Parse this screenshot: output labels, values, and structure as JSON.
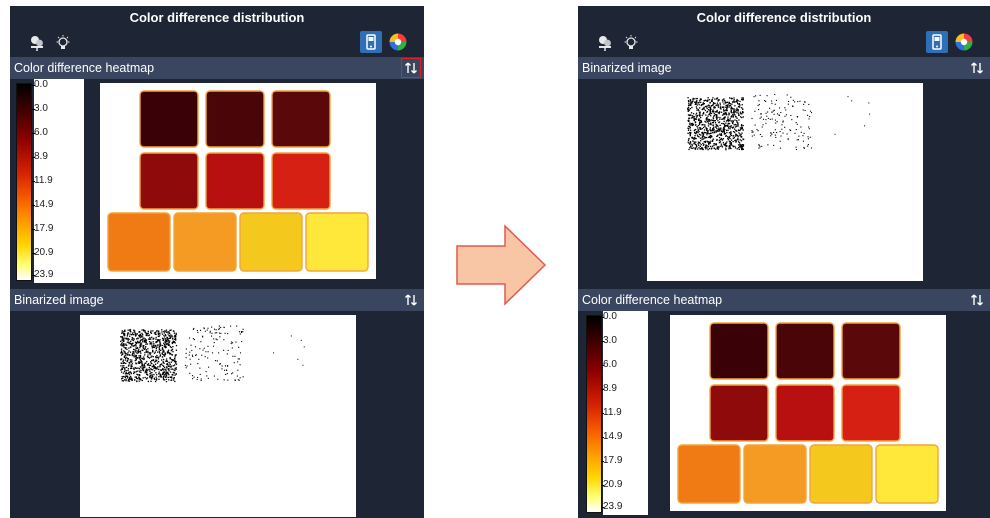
{
  "left": {
    "title": "Color difference distribution",
    "section_top": "Color difference heatmap",
    "section_bottom": "Binarized image"
  },
  "right": {
    "title": "Color difference distribution",
    "section_top": "Binarized image",
    "section_bottom": "Color difference heatmap"
  },
  "colorbar_ticks": [
    "0.0",
    "3.0",
    "6.0",
    "8.9",
    "11.9",
    "14.9",
    "17.9",
    "20.9",
    "23.9"
  ],
  "icons": {
    "toolbar": [
      "objects-icon",
      "lightbulb-icon",
      "phone-display-icon",
      "color-wheel-icon"
    ],
    "swap": "swap-vertical-icon",
    "transition": "right-arrow-icon"
  },
  "colors": {
    "panel_bg": "#1e2535",
    "header_bg": "#3a4660",
    "active_tool": "#2f6fb5",
    "highlight_border": "#e02020",
    "arrow_fill": "#f8c6a4",
    "arrow_stroke": "#e05a50"
  },
  "tiles": [
    {
      "row": 1,
      "colors": [
        "#3a0206",
        "#4a0508",
        "#5a0809"
      ]
    },
    {
      "row": 2,
      "colors": [
        "#8f0b0b",
        "#b81010",
        "#d62014"
      ]
    },
    {
      "row": 3,
      "colors": [
        "#f07a14",
        "#f59a22",
        "#f5c81e",
        "#ffe83a"
      ]
    }
  ]
}
